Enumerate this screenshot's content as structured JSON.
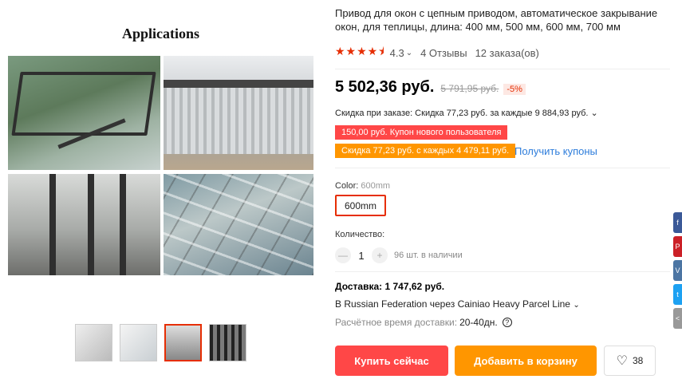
{
  "gallery": {
    "caption": "Applications",
    "thumbnails": [
      "thumb-1",
      "thumb-2",
      "thumb-3",
      "thumb-4"
    ],
    "active_thumbnail": 3
  },
  "product": {
    "title": "Привод для окон с цепным приводом, автоматическое закрывание окон, для теплицы, длина: 400 мм, 500 мм, 600 мм, 700 мм",
    "rating": "4.3",
    "rating_stars": 4.3,
    "reviews": "4 Отзывы",
    "orders": "12 заказа(ов)"
  },
  "price": {
    "current": "5 502,36 руб.",
    "old": "5 791,95 руб.",
    "discount": "-5%"
  },
  "discounts": {
    "order_discount": "Скидка при заказе: Скидка 77,23 руб. за каждые 9 884,93 руб.",
    "coupon_new_user": "150,00 руб. Купон нового пользователя",
    "coupon_every": "Скидка 77,23 руб. с каждых 4 479,11 руб.",
    "get_coupons": "Получить купоны"
  },
  "options": {
    "color_label": "Color:",
    "color_selected": "600mm",
    "color_option": "600mm"
  },
  "quantity": {
    "label": "Количество:",
    "value": "1",
    "minus": "—",
    "plus": "+",
    "available": "96 шт. в наличии"
  },
  "shipping": {
    "title": "Доставка: 1 747,62 руб.",
    "via": "В Russian Federation через Cainiao Heavy Parcel Line",
    "time_label": "Расчётное время доставки:",
    "time_value": "20-40дн.",
    "help": "?"
  },
  "actions": {
    "buy_now": "Купить сейчас",
    "add_to_cart": "Добавить в корзину",
    "wishlist_count": "38"
  },
  "social": {
    "items": [
      {
        "name": "facebook",
        "color": "#3b5998",
        "glyph": "f"
      },
      {
        "name": "pinterest",
        "color": "#cb2027",
        "glyph": "P"
      },
      {
        "name": "vk",
        "color": "#4c75a3",
        "glyph": "V"
      },
      {
        "name": "twitter",
        "color": "#1da1f2",
        "glyph": "t"
      },
      {
        "name": "share",
        "color": "#999999",
        "glyph": "<"
      }
    ]
  },
  "colors": {
    "accent_red": "#ff4747",
    "accent_orange": "#ff9600",
    "link_blue": "#2e7ddb",
    "star": "#e62e04"
  }
}
